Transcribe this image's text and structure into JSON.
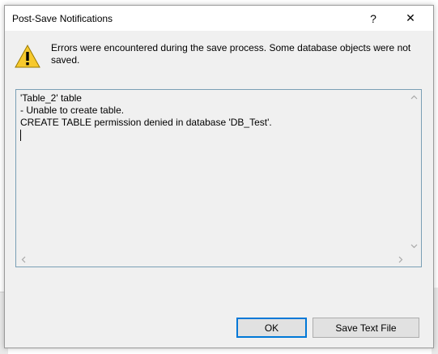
{
  "dialog": {
    "title": "Post-Save Notifications",
    "help_glyph": "?",
    "close_glyph": "✕",
    "message": "Errors were encountered during the save process. Some database objects were not saved.",
    "details_lines": [
      "'Table_2' table",
      "- Unable to create table.",
      "CREATE TABLE permission denied in database 'DB_Test'."
    ],
    "buttons": {
      "ok_label": "OK",
      "save_label": "Save Text File"
    },
    "icons": {
      "warning": "warning-icon",
      "help": "help-icon",
      "close": "close-icon"
    },
    "colors": {
      "accent": "#0078d7",
      "warning_fill": "#f7c92d"
    }
  }
}
